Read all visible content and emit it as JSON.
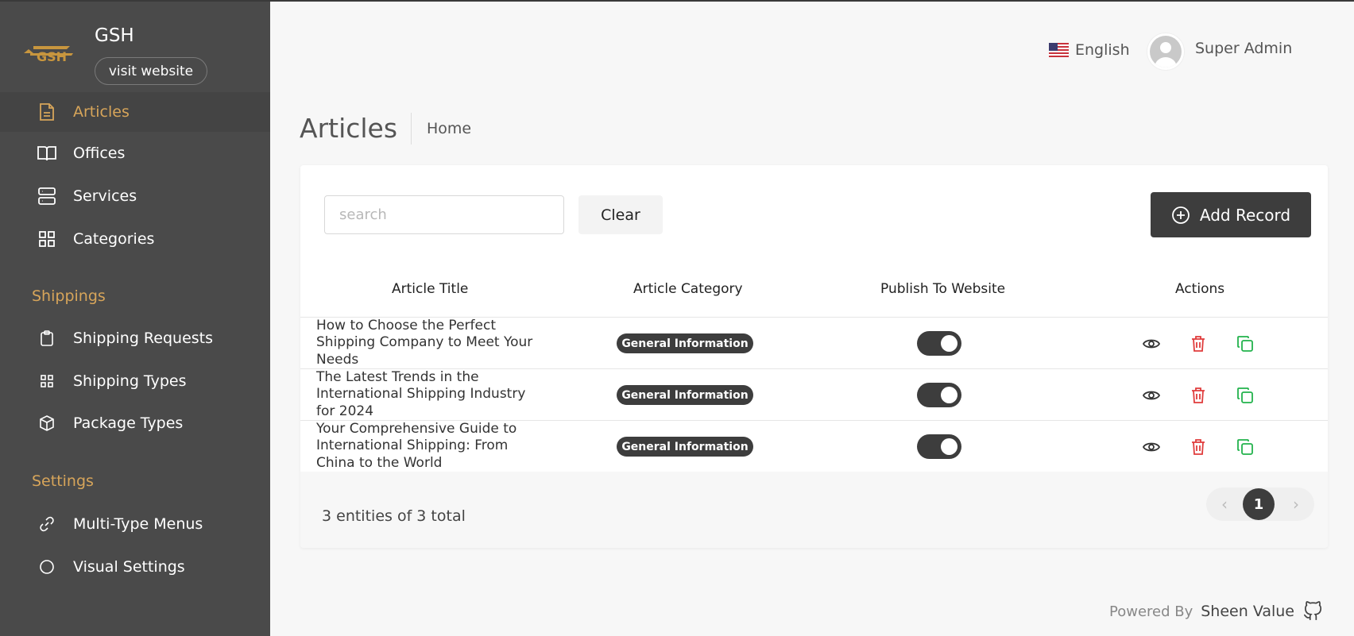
{
  "sidebar": {
    "brand": "GSH",
    "visit_label": "visit website",
    "items": [
      {
        "label": "Articles"
      },
      {
        "label": "Offices"
      },
      {
        "label": "Services"
      },
      {
        "label": "Categories"
      }
    ],
    "sections": [
      {
        "label": "Shippings",
        "items": [
          {
            "label": "Shipping Requests"
          },
          {
            "label": "Shipping Types"
          },
          {
            "label": "Package Types"
          }
        ]
      },
      {
        "label": "Settings",
        "items": [
          {
            "label": "Multi-Type Menus"
          },
          {
            "label": "Visual Settings"
          }
        ]
      }
    ]
  },
  "header": {
    "language": "English",
    "user": "Super Admin"
  },
  "page": {
    "title": "Articles",
    "breadcrumb": "Home"
  },
  "toolbar": {
    "search_placeholder": "search",
    "clear_label": "Clear",
    "add_label": "Add Record"
  },
  "table": {
    "columns": [
      "Article Title",
      "Article Category",
      "Publish To Website",
      "Actions"
    ],
    "rows": [
      {
        "title": "How to Choose the Perfect Shipping Company to Meet Your Needs",
        "category": "General Information",
        "published": true
      },
      {
        "title": "The Latest Trends in the International Shipping Industry for 2024",
        "category": "General Information",
        "published": true
      },
      {
        "title": "Your Comprehensive Guide to International Shipping: From China to the World",
        "category": "General Information",
        "published": true
      }
    ]
  },
  "pagination": {
    "summary": "3 entities of 3 total",
    "current_page": "1"
  },
  "footer": {
    "powered_by": "Powered By",
    "company": "Sheen Value"
  },
  "colors": {
    "sidebar_bg": "#4a4a4a",
    "accent": "#d7a55a",
    "primary_dark": "#3d3d3d",
    "delete": "#e03c3c",
    "copy": "#22b24c"
  }
}
